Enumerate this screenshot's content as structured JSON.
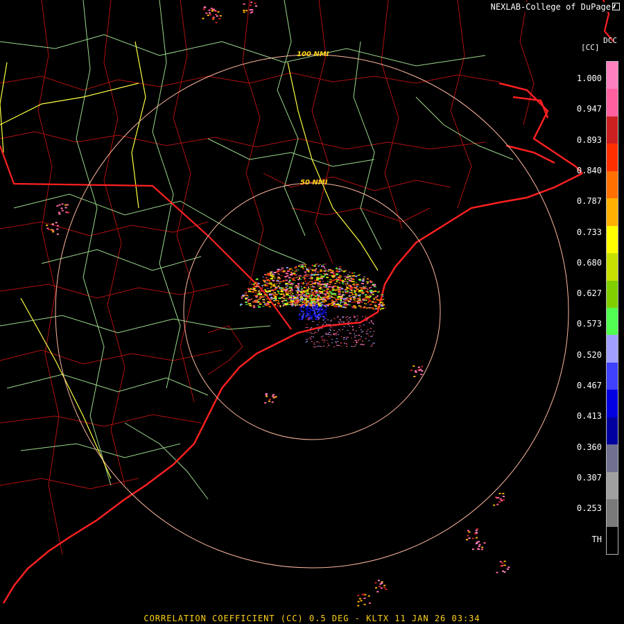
{
  "header": {
    "credit": "NEXLAB-College of DuPage",
    "station_id": "DCC"
  },
  "colorscale": {
    "title": "[CC]",
    "labels": [
      "1.000",
      "0.947",
      "0.893",
      "0.840",
      "0.787",
      "0.733",
      "0.680",
      "0.627",
      "0.573",
      "0.520",
      "0.467",
      "0.413",
      "0.360",
      "0.307",
      "0.253",
      "TH"
    ],
    "colors": [
      "#ff80c0",
      "#ff60a0",
      "#cc2020",
      "#ff3000",
      "#ff7000",
      "#ffb000",
      "#ffff00",
      "#c8e000",
      "#80d000",
      "#50ff50",
      "#a0a0ff",
      "#4040ff",
      "#0000e0",
      "#0000a0",
      "#707090",
      "#a0a0a0",
      "#7a7a7a",
      "#000000"
    ]
  },
  "map": {
    "range_rings": [
      "50 NMI",
      "100 NMI"
    ],
    "colors": {
      "background": "#000000",
      "state_border": "#ff2020",
      "county_border": "#b01010",
      "highway": "#9bd98b",
      "interstate": "#ffff40",
      "range_ring": "#ffb8a0"
    }
  },
  "footer": {
    "caption": "CORRELATION COEFFICIENT (CC) 0.5 DEG - KLTX 11 JAN 26 03:34"
  }
}
